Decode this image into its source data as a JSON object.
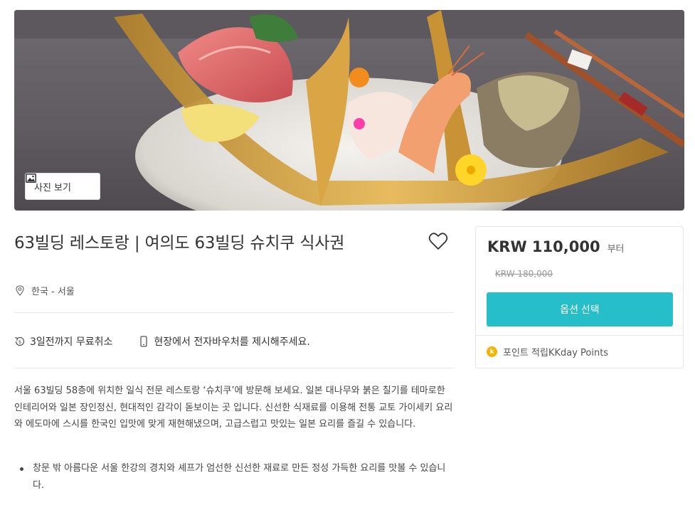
{
  "gallery": {
    "photo_button_label": "사진 보기"
  },
  "product": {
    "title": "63빌딩 레스토랑 | 여의도 63빌딩 슈치쿠 식사권",
    "location": "한국 - 서울",
    "features": [
      {
        "icon": "cancel-refund-icon",
        "label": "3일전까지 무료취소"
      },
      {
        "icon": "phone-icon",
        "label": "현장에서 전자바우처를 제시해주세요."
      }
    ],
    "description": "서울 63빌딩 58층에 위치한 일식 전문 레스토랑 ‘슈치쿠’에 방문해 보세요. 일본 대나무와 붉은 칠기를 테마로한 인테리어와 일본 장인정신, 현대적인 감각이 돋보이는 곳 입니다. 신선한 식재료를 이용해 전통 교토 가이세키 요리와 에도마에 스시를 한국인 입맛에 맞게 재현해냈으며, 고급스럽고 맛있는 일본 요리를 즐길 수 있습니다.",
    "highlights": [
      "창문 밖 아름다운 서울 한강의 경치와 셰프가 엄선한 신선한 재료로 만든 정성 가득한 요리를 맛볼 수 있습니다."
    ]
  },
  "pricing": {
    "price": "KRW 110,000",
    "price_suffix": "부터",
    "original_price": "KRW 180,000",
    "option_button_label": "옵션 선택",
    "points_icon_letter": "k",
    "points_label": "포인트 적립KKday Points"
  },
  "colors": {
    "accent": "#26bec9",
    "points": "#f5b400"
  }
}
